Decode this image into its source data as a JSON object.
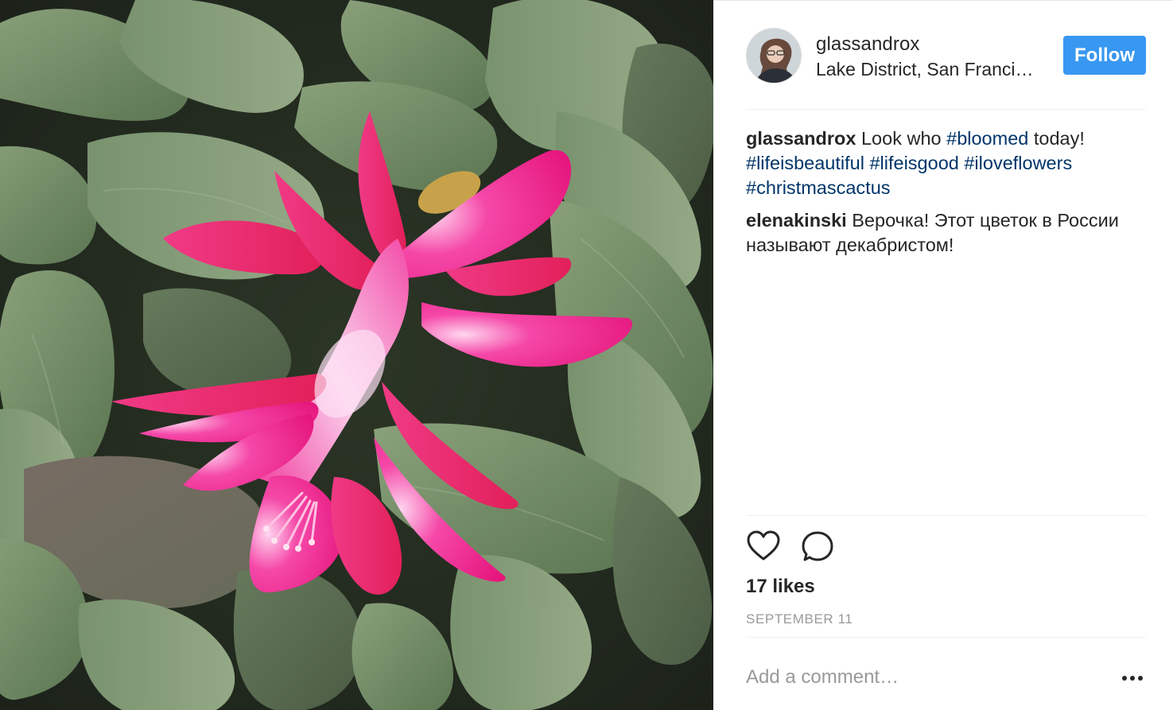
{
  "post": {
    "image_subject": "pink christmas cactus flower",
    "colors": {
      "accent": "#3897f0",
      "hashtag": "#003569",
      "muted": "#999999",
      "text": "#262626"
    }
  },
  "header": {
    "username": "glassandrox",
    "location": "Lake District, San Francisco",
    "follow_label": "Follow"
  },
  "comments": [
    {
      "author": "glassandrox",
      "segments": [
        {
          "text": "Look who ",
          "type": "text"
        },
        {
          "text": "#bloomed",
          "type": "tag"
        },
        {
          "text": " today! ",
          "type": "text"
        },
        {
          "text": "#lifeisbeautiful",
          "type": "tag"
        },
        {
          "text": " ",
          "type": "text"
        },
        {
          "text": "#lifeisgood",
          "type": "tag"
        },
        {
          "text": " ",
          "type": "text"
        },
        {
          "text": "#iloveflowers",
          "type": "tag"
        },
        {
          "text": " ",
          "type": "text"
        },
        {
          "text": "#christmascactus",
          "type": "tag"
        }
      ]
    },
    {
      "author": "elenakinski",
      "segments": [
        {
          "text": "Верочка! Этот цветок в России называют декабристом!",
          "type": "text"
        }
      ]
    }
  ],
  "actions": {
    "like_icon": "heart-icon",
    "comment_icon": "speech-bubble-icon",
    "more_icon": "ellipsis-icon"
  },
  "likes_text": "17 likes",
  "date_text": "SEPTEMBER 11",
  "comment_input": {
    "placeholder": "Add a comment…",
    "value": ""
  }
}
